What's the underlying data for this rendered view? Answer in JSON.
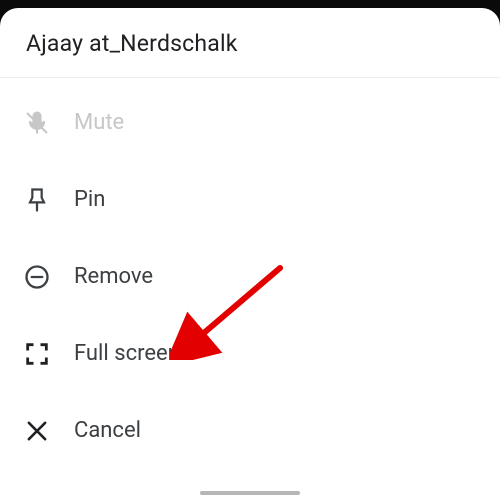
{
  "header": {
    "title": "Ajaay at_Nerdschalk"
  },
  "menu": {
    "items": [
      {
        "label": "Mute",
        "icon": "mute-icon",
        "enabled": false
      },
      {
        "label": "Pin",
        "icon": "pin-icon",
        "enabled": true
      },
      {
        "label": "Remove",
        "icon": "remove-icon",
        "enabled": true
      },
      {
        "label": "Full screen",
        "icon": "fullscreen-icon",
        "enabled": true
      },
      {
        "label": "Cancel",
        "icon": "close-icon",
        "enabled": true
      }
    ]
  },
  "annotation": {
    "arrow_target": "menu.items.3",
    "arrow_color": "#e30000"
  }
}
